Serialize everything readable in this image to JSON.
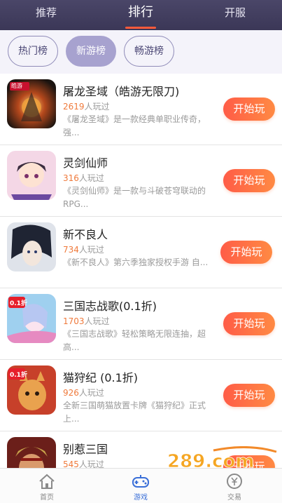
{
  "header": {
    "tabs": [
      {
        "label": "推荐"
      },
      {
        "label": "排行"
      },
      {
        "label": "开服"
      }
    ]
  },
  "subtabs": [
    {
      "label": "热门榜"
    },
    {
      "label": "新游榜"
    },
    {
      "label": "畅游榜"
    }
  ],
  "games": [
    {
      "title": "屠龙圣域（皓游无限刀)",
      "count": "2619",
      "played_suffix": "人玩过",
      "desc": "《屠龙圣域》是一款经典单职业传奇，强...",
      "button": "开始玩"
    },
    {
      "title": "灵剑仙师",
      "count": "316",
      "played_suffix": "人玩过",
      "desc": "《灵剑仙师》是一款与斗破苍穹联动的RPG...",
      "button": "开始玩"
    },
    {
      "title": "新不良人",
      "count": "734",
      "played_suffix": "人玩过",
      "desc": "《新不良人》第六季独家授权手游 自...",
      "button": "开始玩"
    },
    {
      "title": "三国志战歌(0.1折)",
      "count": "1703",
      "played_suffix": "人玩过",
      "desc": "《三国志战歌》轻松策略无限连抽，超高...",
      "button": "开始玩"
    },
    {
      "title": "猫狩纪 (0.1折)",
      "count": "926",
      "played_suffix": "人玩过",
      "desc": "全新三国萌猫放置卡牌《猫狩纪》正式上...",
      "button": "开始玩"
    },
    {
      "title": "别惹三国",
      "count": "545",
      "played_suffix": "人玩过",
      "desc": "",
      "button": "开始玩"
    }
  ],
  "icon_badges": {
    "game1": "皓游",
    "game4": "0.1折",
    "game5": "0.1折"
  },
  "bottom_nav": [
    {
      "label": "首页",
      "icon": "home-icon"
    },
    {
      "label": "游戏",
      "icon": "gamepad-icon"
    },
    {
      "label": "交易",
      "icon": "yen-icon"
    }
  ],
  "watermark": {
    "text": "289.com",
    "subtext": "手游网"
  },
  "colors": {
    "header_bg": "#403c5e",
    "accent_orange": "#ff6a45",
    "pill_active": "#a7a2cf",
    "nav_active": "#3a6fd8"
  }
}
